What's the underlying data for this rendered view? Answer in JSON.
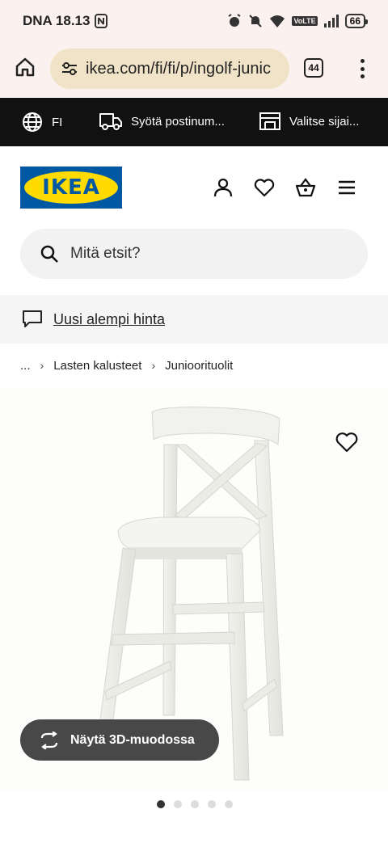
{
  "status_bar": {
    "carrier_time": "DNA 18.13",
    "battery": "66",
    "lte_label": "VoLTE"
  },
  "browser": {
    "url": "ikea.com/fi/fi/p/ingolf-junic",
    "tab_count": "44"
  },
  "util_bar": {
    "language": "FI",
    "postcode": "Syötä postinum...",
    "store": "Valitse sijai..."
  },
  "header": {
    "logo_text": "IKEA",
    "colors": {
      "logo_blue": "#0058a3",
      "logo_yellow": "#ffdb00"
    }
  },
  "search": {
    "placeholder": "Mitä etsit?"
  },
  "banner": {
    "text": "Uusi alempi hinta"
  },
  "breadcrumb": {
    "items": [
      "...",
      "Lasten kalusteet",
      "Junioorituolit"
    ]
  },
  "product": {
    "view_3d_label": "Näytä 3D-muodossa",
    "image_count": 5,
    "active_image": 1
  },
  "icons": [
    "home-icon",
    "tune-icon",
    "globe-icon",
    "truck-icon",
    "store-icon",
    "user-icon",
    "heart-icon",
    "basket-icon",
    "hamburger-icon",
    "search-icon",
    "chat-icon",
    "rotate-3d-icon"
  ]
}
